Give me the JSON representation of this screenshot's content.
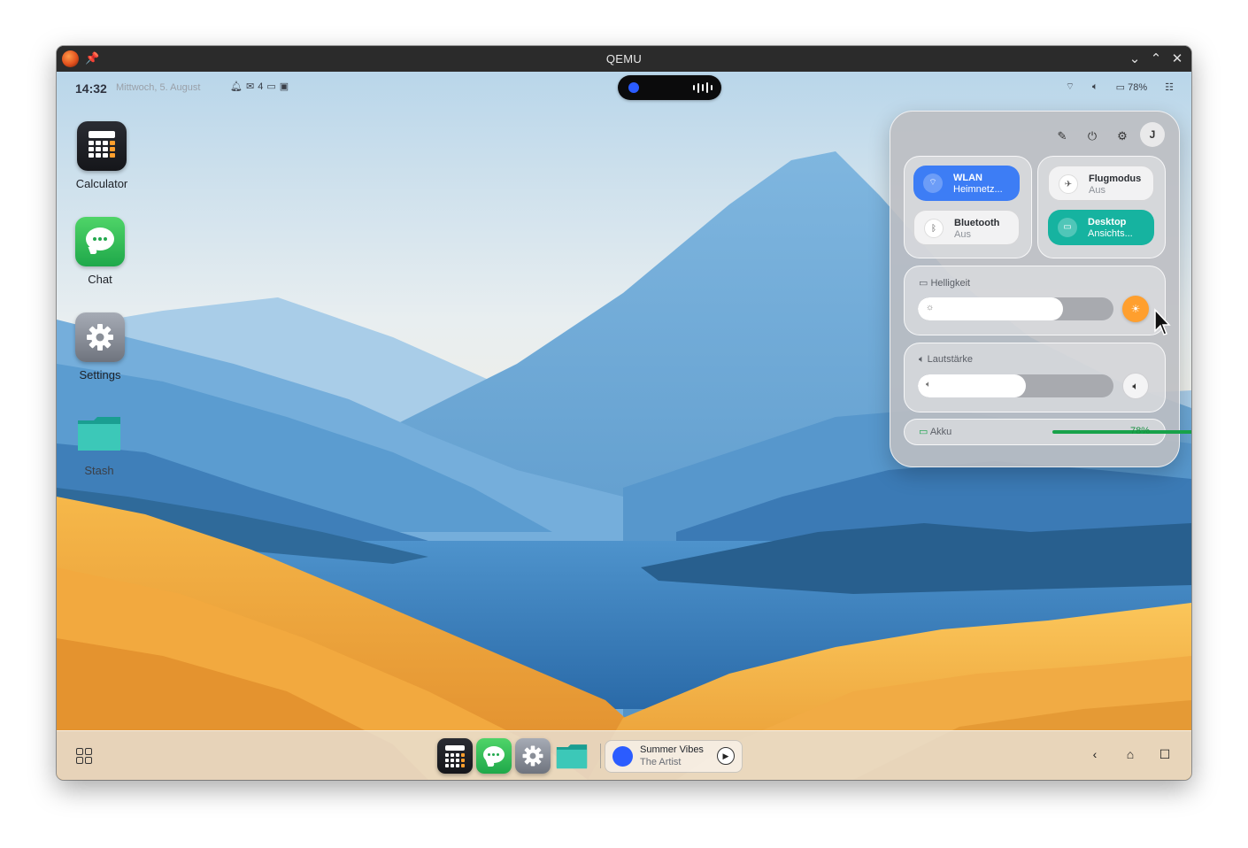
{
  "window": {
    "title": "QEMU",
    "controls": {
      "minimize": "⌄",
      "maximize": "⌃",
      "close": "✕"
    }
  },
  "statusbar": {
    "time": "14:32",
    "date": "Mittwoch, 5. August",
    "notifications": {
      "mail_count": "4"
    },
    "battery": "78%"
  },
  "desktop": {
    "icons": [
      {
        "label": "Calculator"
      },
      {
        "label": "Chat"
      },
      {
        "label": "Settings"
      },
      {
        "label": "Stash"
      }
    ]
  },
  "quick_settings": {
    "avatar_initial": "J",
    "wlan": {
      "label": "WLAN",
      "status": "Heimnetz..."
    },
    "bluetooth": {
      "label": "Bluetooth",
      "status": "Aus"
    },
    "airplane": {
      "label": "Flugmodus",
      "status": "Aus"
    },
    "desktop": {
      "label": "Desktop",
      "status": "Ansichts..."
    },
    "brightness": {
      "label": "Helligkeit",
      "value": 0.74
    },
    "volume": {
      "label": "Lautstärke",
      "value": 0.55
    },
    "battery": {
      "label": "Akku",
      "value": "78%"
    }
  },
  "taskbar": {
    "player": {
      "song": "Summer Vibes",
      "artist": "The Artist"
    }
  },
  "colors": {
    "accent_blue": "#3d7df5",
    "teal": "#16b3a0",
    "sun": "#ff9f2e",
    "battery_green": "#18a24a"
  }
}
